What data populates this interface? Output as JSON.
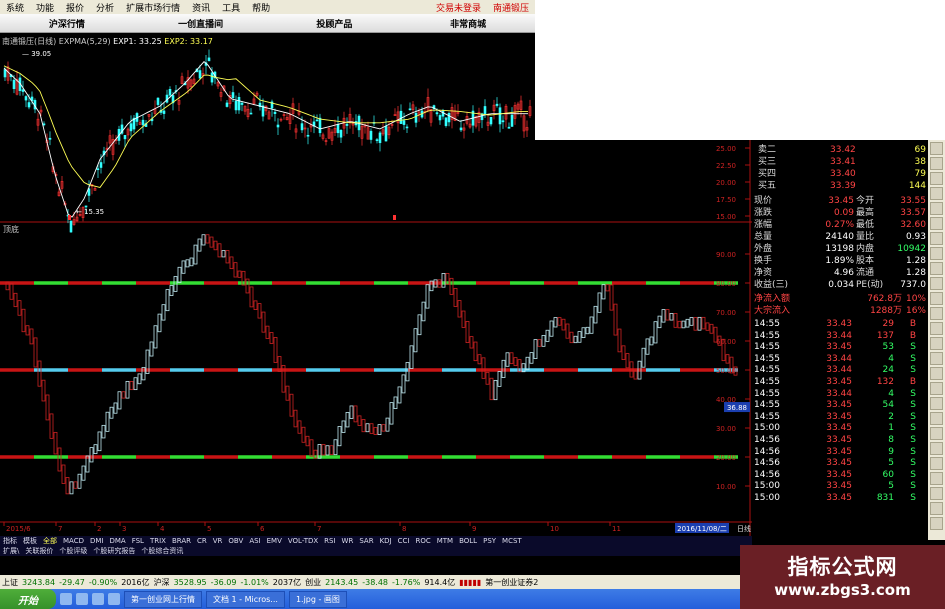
{
  "menubar": {
    "items": [
      "系统",
      "功能",
      "报价",
      "分析",
      "扩展市场行情",
      "资讯",
      "工具",
      "帮助"
    ],
    "right_items": [
      "交易未登录",
      "南通锻压"
    ]
  },
  "quickbar": {
    "items": [
      "沪深行情",
      "一创直播间",
      "投顾产品",
      "非常商城"
    ]
  },
  "chart_info": {
    "stock": "南通锻压(日线)",
    "indicator": "EXPMA(5,29)",
    "exp1": "EXP1: 33.25",
    "exp2": "EXP2: 33.17"
  },
  "kline": {
    "high_label": "39.05",
    "low_label": "15.35",
    "price_axis": [
      "25.00",
      "22.50",
      "20.00",
      "17.50",
      "15.00"
    ]
  },
  "indicator_panel": {
    "title": "顶底",
    "axis": [
      "90.00",
      "80.00",
      "70.00",
      "60.00",
      "50.00",
      "40.00",
      "30.00",
      "20.00",
      "10.00"
    ],
    "current_value": "36.88",
    "levels": [
      80,
      50,
      20
    ]
  },
  "date_axis": {
    "labels": [
      "2015/6",
      "7",
      "2",
      "3",
      "4",
      "5",
      "6",
      "7",
      "8",
      "9",
      "10",
      "11"
    ],
    "current_date": "2016/11/08/二",
    "period": "日线"
  },
  "quotes": {
    "order_book": [
      {
        "label": "卖二",
        "price": "33.42",
        "vol": "69"
      },
      {
        "label": "买三",
        "price": "33.41",
        "vol": "38"
      },
      {
        "label": "买四",
        "price": "33.40",
        "vol": "79"
      },
      {
        "label": "买五",
        "price": "33.39",
        "vol": "144"
      }
    ],
    "stats": [
      {
        "l": "现价",
        "v": "33.45",
        "l2": "今开",
        "v2": "33.55"
      },
      {
        "l": "涨跌",
        "v": "0.09",
        "l2": "最高",
        "v2": "33.57"
      },
      {
        "l": "涨幅",
        "v": "0.27%",
        "l2": "最低",
        "v2": "32.60"
      },
      {
        "l": "总量",
        "v": "24140",
        "l2": "量比",
        "v2": "0.93"
      },
      {
        "l": "外盘",
        "v": "13198",
        "l2": "内盘",
        "v2": "10942"
      },
      {
        "l": "换手",
        "v": "1.89%",
        "l2": "股本",
        "v2": "1.28"
      },
      {
        "l": "净资",
        "v": "4.96",
        "l2": "流通",
        "v2": "1.28"
      },
      {
        "l": "收益(三)",
        "v": "0.034",
        "l2": "PE(动)",
        "v2": "737.0"
      }
    ],
    "flows": [
      {
        "l": "净流入额",
        "v": "762.8万",
        "p": "10%"
      },
      {
        "l": "大宗流入",
        "v": "1288万",
        "p": "16%"
      }
    ],
    "ticks": [
      {
        "t": "14:55",
        "p": "33.43",
        "v": "29",
        "s": "B"
      },
      {
        "t": "14:55",
        "p": "33.44",
        "v": "137",
        "s": "B"
      },
      {
        "t": "14:55",
        "p": "33.45",
        "v": "53",
        "s": "S"
      },
      {
        "t": "14:55",
        "p": "33.44",
        "v": "4",
        "s": "S"
      },
      {
        "t": "14:55",
        "p": "33.44",
        "v": "24",
        "s": "S"
      },
      {
        "t": "14:55",
        "p": "33.45",
        "v": "132",
        "s": "B"
      },
      {
        "t": "14:55",
        "p": "33.44",
        "v": "4",
        "s": "S"
      },
      {
        "t": "14:55",
        "p": "33.45",
        "v": "54",
        "s": "S"
      },
      {
        "t": "14:55",
        "p": "33.45",
        "v": "2",
        "s": "S"
      },
      {
        "t": "15:00",
        "p": "33.45",
        "v": "1",
        "s": "S"
      },
      {
        "t": "14:56",
        "p": "33.45",
        "v": "8",
        "s": "S"
      },
      {
        "t": "14:56",
        "p": "33.45",
        "v": "9",
        "s": "S"
      },
      {
        "t": "14:56",
        "p": "33.45",
        "v": "5",
        "s": "S"
      },
      {
        "t": "14:56",
        "p": "33.45",
        "v": "60",
        "s": "S"
      },
      {
        "t": "15:00",
        "p": "33.45",
        "v": "5",
        "s": "S"
      },
      {
        "t": "15:00",
        "p": "33.45",
        "v": "831",
        "s": "S"
      }
    ]
  },
  "bottom_tabs": [
    "指标",
    "模板",
    "全部",
    "MACD",
    "DMI",
    "DMA",
    "FSL",
    "TRIX",
    "BRAR",
    "CR",
    "VR",
    "OBV",
    "ASI",
    "EMV",
    "VOL-TDX",
    "RSI",
    "WR",
    "SAR",
    "KDJ",
    "CCI",
    "ROC",
    "MTM",
    "BOLL",
    "PSY",
    "MCST"
  ],
  "sub_tabs": [
    "扩展\\",
    "关联报价",
    "个股评级",
    "个股研究报告",
    "个股综合资讯"
  ],
  "statusbar": {
    "sh_label": "上证",
    "sh_val": "3243.84",
    "sh_chg": "-29.47",
    "sh_pct": "-0.90%",
    "sh_amt": "2016亿",
    "hs_label": "沪深",
    "hs_val": "3528.95",
    "hs_chg": "-36.09",
    "hs_pct": "-1.01%",
    "hs_amt": "2037亿",
    "cy_label": "创业",
    "cy_val": "2143.45",
    "cy_chg": "-38.48",
    "cy_pct": "-1.76%",
    "cy_amt": "914.4亿",
    "broker": "第一创业证券2"
  },
  "taskbar": {
    "start": "开始",
    "windows": [
      "第一创业网上行情",
      "文档 1 - Micros...",
      "1.jpg - 画图"
    ]
  },
  "watermark": {
    "line1": "指标公式网",
    "line2": "www.zbgs3.com"
  },
  "colors": {
    "up": "#ff3333",
    "down": "#33ffff",
    "level_red": "#c81414",
    "level_green": "#33dd33",
    "level_cyan": "#55ccee",
    "price_red": "#ff4444",
    "text_yellow": "#ffff55"
  }
}
